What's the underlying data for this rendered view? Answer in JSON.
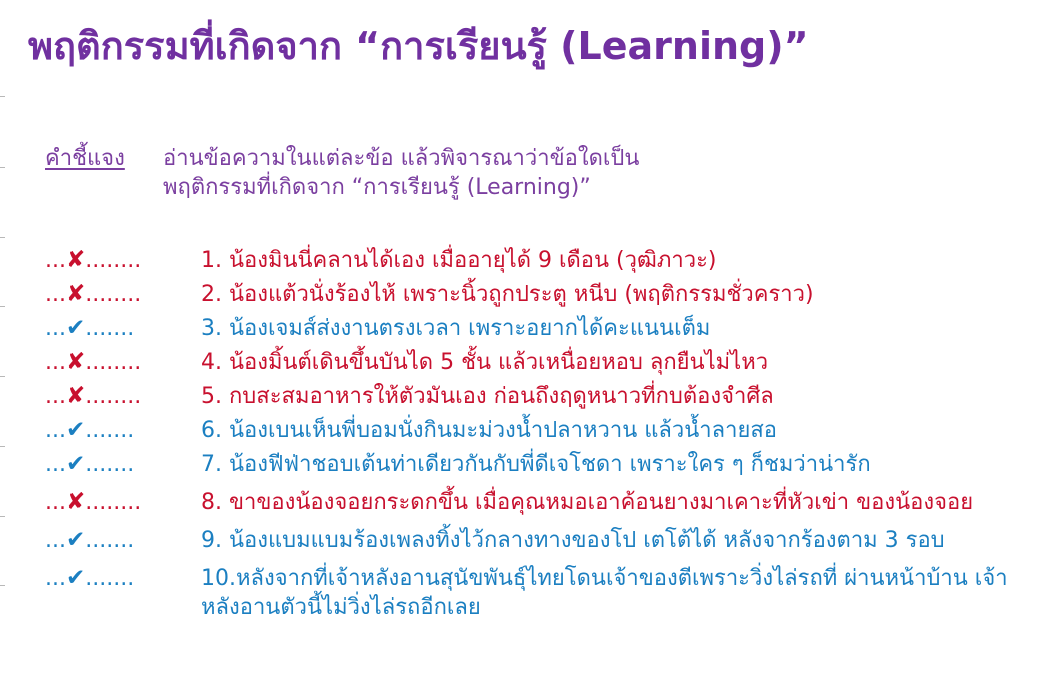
{
  "title": {
    "text": "พฤติกรรมที่เกิดจาก “การเรียนรู้ (Learning)”",
    "color": "#7030a0"
  },
  "instructions": {
    "label": "คำชี้แจง",
    "line1": "อ่านข้อความในแต่ละข้อ แล้วพิจารณาว่าข้อใดเป็น",
    "line2": "พฤติกรรมที่เกิดจาก “การเรียนรู้ (Learning)”",
    "color": "#7b3fa0"
  },
  "colors": {
    "wrong": "#c8102e",
    "right": "#1b7fc1"
  },
  "items": [
    {
      "answer": "wrong",
      "lead": "...",
      "mark": "✘",
      "dots": "........",
      "text": "1. น้องมินนี่คลานได้เอง เมื่ออายุได้ 9 เดือน (วุฒิภาวะ)"
    },
    {
      "answer": "wrong",
      "lead": "...",
      "mark": "✘",
      "dots": "........",
      "text": "2. น้องแต้วนั่งร้องไห้ เพราะนิ้วถูกประตู หนีบ (พฤติกรรมชั่วคราว)"
    },
    {
      "answer": "right",
      "lead": "...",
      "mark": "✔",
      "dots": ".......",
      "text": "3. น้องเจมส์ส่งงานตรงเวลา เพราะอยากได้คะแนนเต็ม"
    },
    {
      "answer": "wrong",
      "lead": "...",
      "mark": "✘",
      "dots": "........",
      "text": "4. น้องมิ้นต์เดินขึ้นบันได 5 ชั้น แล้วเหนื่อยหอบ ลุกยืนไม่ไหว"
    },
    {
      "answer": "wrong",
      "lead": "...",
      "mark": "✘",
      "dots": "........",
      "text": "5. กบสะสมอาหารให้ตัวมันเอง ก่อนถึงฤดูหนาวที่กบต้องจำศีล"
    },
    {
      "answer": "right",
      "lead": "...",
      "mark": "✔",
      "dots": ".......",
      "text": "6. น้องเบนเห็นพี่บอมนั่งกินมะม่วงน้ำปลาหวาน แล้วน้ำลายสอ"
    },
    {
      "answer": "right",
      "lead": "...",
      "mark": "✔",
      "dots": ".......",
      "text": "7. น้องฟีฟ่าชอบเต้นท่าเดียวกันกับพี่ดีเจโชดา เพราะใคร ๆ ก็ชมว่าน่ารัก"
    },
    {
      "answer": "wrong",
      "lead": "...",
      "mark": "✘",
      "dots": "........",
      "text": "8. ขาของน้องจอยกระดกขึ้น เมื่อคุณหมอเอาค้อนยางมาเคาะที่หัวเข่า ของน้องจอย"
    },
    {
      "answer": "right",
      "lead": "...",
      "mark": "✔",
      "dots": ".......",
      "text": "9. น้องแบมแบมร้องเพลงทิ้งไว้กลางทางของโป เตโต้ได้ หลังจากร้องตาม 3 รอบ"
    },
    {
      "answer": "right",
      "lead": "...",
      "mark": "✔",
      "dots": ".......",
      "text": "10.หลังจากที่เจ้าหลังอานสุนัขพันธุ์ไทยโดนเจ้าของตีเพราะวิ่งไล่รถที่ ผ่านหน้าบ้าน เจ้าหลังอานตัวนี้ไม่วิ่งไล่รถอีกเลย"
    }
  ]
}
